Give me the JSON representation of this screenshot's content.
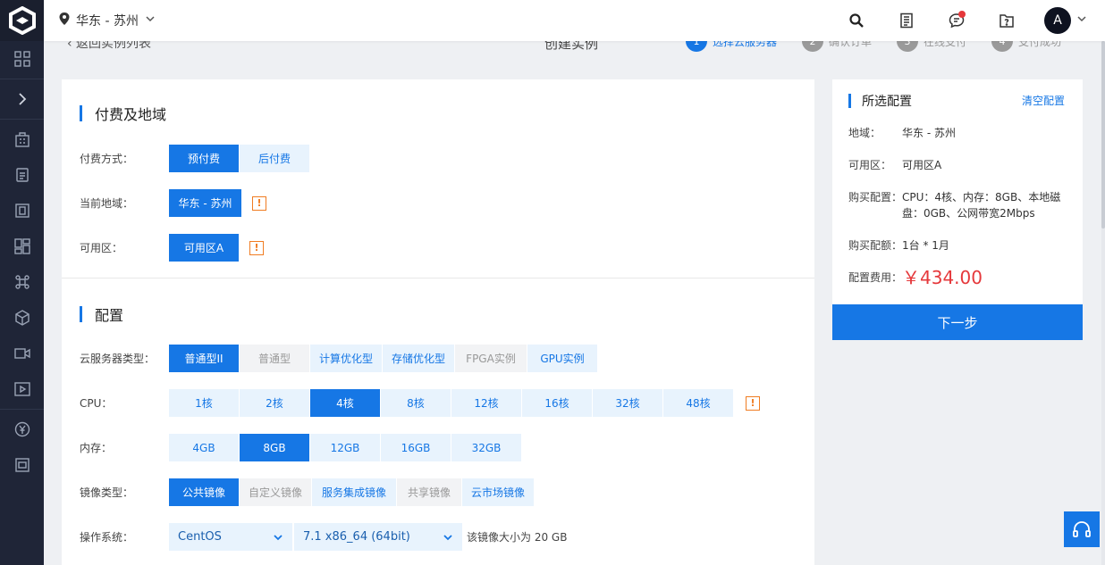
{
  "header": {
    "region": "华东 - 苏州",
    "avatar_letter": "A"
  },
  "page": {
    "back_text": "‹ 返回实例列表",
    "title": "创建实例",
    "steps": [
      {
        "num": "1",
        "label": "选择云服务器"
      },
      {
        "num": "2",
        "label": "确认订单"
      },
      {
        "num": "3",
        "label": "在线支付"
      },
      {
        "num": "4",
        "label": "支付成功"
      }
    ]
  },
  "billing": {
    "title": "付费及地域",
    "pay_label": "付费方式：",
    "pay_options": [
      "预付费",
      "后付费"
    ],
    "region_label": "当前地域：",
    "region_value": "华东 - 苏州",
    "zone_label": "可用区：",
    "zone_value": "可用区A",
    "warn_glyph": "!"
  },
  "config": {
    "title": "配置",
    "type_label": "云服务器类型：",
    "types": [
      "普通型II",
      "普通型",
      "计算优化型",
      "存储优化型",
      "FPGA实例",
      "GPU实例"
    ],
    "cpu_label": "CPU：",
    "cpus": [
      "1核",
      "2核",
      "4核",
      "8核",
      "12核",
      "16核",
      "32核",
      "48核"
    ],
    "mem_label": "内存：",
    "mems": [
      "4GB",
      "8GB",
      "12GB",
      "16GB",
      "32GB"
    ],
    "image_label": "镜像类型：",
    "images": [
      "公共镜像",
      "自定义镜像",
      "服务集成镜像",
      "共享镜像",
      "云市场镜像"
    ],
    "os_label": "操作系统：",
    "os_name": "CentOS",
    "os_version": "7.1 x86_64 (64bit)",
    "image_size_note": "该镜像大小为 20 GB"
  },
  "summary": {
    "title": "所选配置",
    "clear": "清空配置",
    "region_k": "地域：",
    "region_v": "华东 - 苏州",
    "zone_k": "可用区：",
    "zone_v": "可用区A",
    "spec_k": "购买配置：",
    "spec_v": "CPU：4核、内存：8GB、本地磁盘：0GB、公网带宽2Mbps",
    "quota_k": "购买配额：",
    "quota_v": "1台 * 1月",
    "fee_k": "配置费用：",
    "fee_v": "￥434.00",
    "next": "下一步"
  },
  "colors": {
    "accent": "#1677e5",
    "sidebar": "#1f2537",
    "price": "#e5383b",
    "warning": "#f07c22"
  }
}
